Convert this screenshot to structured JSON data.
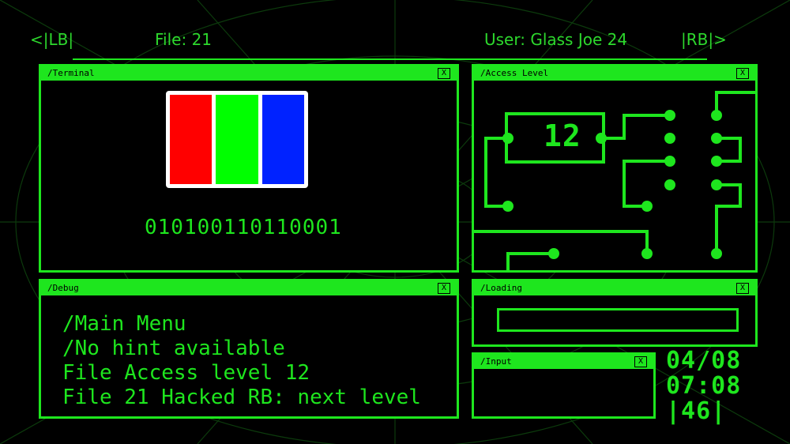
{
  "header": {
    "lb": "<|LB|",
    "file": "File: 21",
    "user": "User: Glass Joe 24",
    "rb": "|RB|>"
  },
  "terminal": {
    "title": "/Terminal",
    "close": "X",
    "binary": "010100110110001",
    "color_bars": [
      "#ff0000",
      "#00ff00",
      "#0022ff"
    ]
  },
  "access": {
    "title": "/Access Level",
    "close": "X",
    "level": "12"
  },
  "debug": {
    "title": "/Debug",
    "close": "X",
    "lines": [
      "/Main Menu",
      "/No hint available",
      "File Access level 12",
      "File 21 Hacked RB: next level"
    ]
  },
  "loading": {
    "title": "/Loading",
    "close": "X",
    "progress": 0
  },
  "input": {
    "title": "/Input",
    "close": "X"
  },
  "clock": {
    "date": "04/08",
    "time": "07:08",
    "seconds": "|46|"
  },
  "colors": {
    "accent": "#1ee61e",
    "background": "#000000"
  }
}
